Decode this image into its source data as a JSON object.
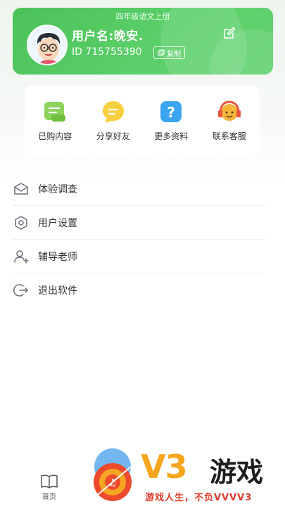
{
  "profile": {
    "grade": "四年级语文上册",
    "username": "用户名:晚安.",
    "user_id": "ID 715755390",
    "copy_label": "复制"
  },
  "shortcuts": [
    {
      "label": "已购内容",
      "icon": "purchased-icon"
    },
    {
      "label": "分享好友",
      "icon": "share-icon"
    },
    {
      "label": "更多资料",
      "icon": "question-icon"
    },
    {
      "label": "联系客服",
      "icon": "headset-icon"
    }
  ],
  "menu": [
    {
      "label": "体验调查",
      "icon": "mail-icon"
    },
    {
      "label": "用户设置",
      "icon": "settings-icon"
    },
    {
      "label": "辅导老师",
      "icon": "add-user-icon"
    },
    {
      "label": "退出软件",
      "icon": "logout-icon"
    }
  ],
  "tabbar": {
    "home_label": "首页"
  },
  "watermark": {
    "brand": "V3",
    "brand_suffix": "游戏",
    "slogan": "游戏人生，不负VVVV3"
  },
  "colors": {
    "accent": "#52c65f",
    "watermark_orange": "#f6a51e",
    "watermark_red": "#e23a2a"
  }
}
